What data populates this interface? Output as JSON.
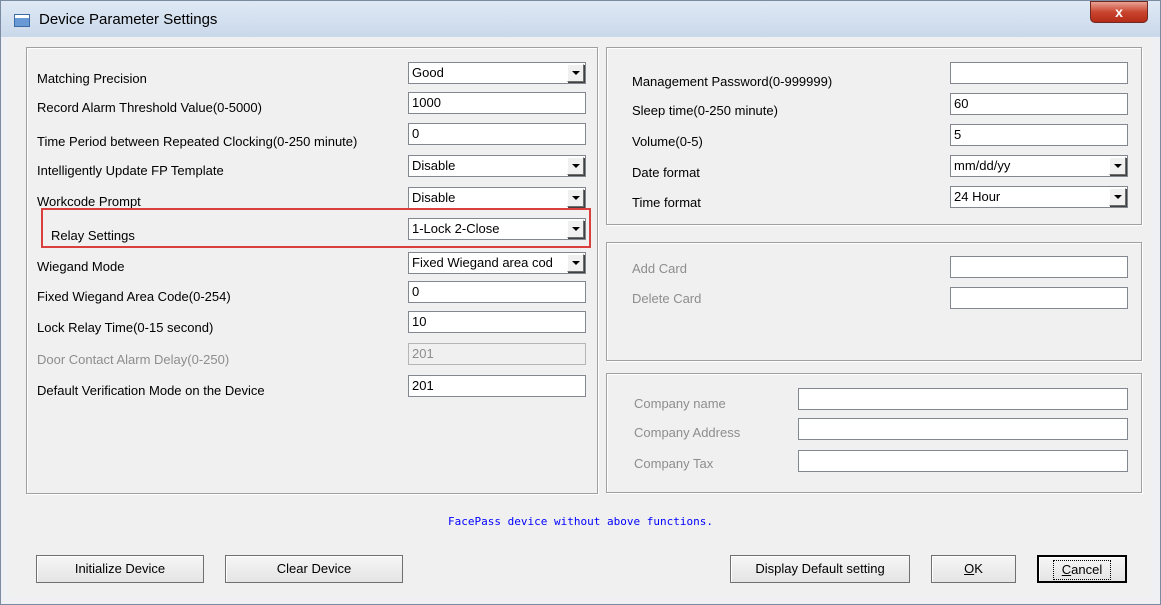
{
  "window": {
    "title": "Device Parameter Settings",
    "close_label": "x"
  },
  "left_panel": {
    "rows": [
      {
        "label": "Matching Precision",
        "value": "Good",
        "type": "combo"
      },
      {
        "label": "Record Alarm Threshold Value(0-5000)",
        "value": "1000",
        "type": "text"
      },
      {
        "label": "Time Period between Repeated Clocking(0-250 minute)",
        "value": "0",
        "type": "text"
      },
      {
        "label": "Intelligently Update  FP Template",
        "value": "Disable",
        "type": "combo"
      },
      {
        "label": "Workcode Prompt",
        "value": "Disable",
        "type": "combo"
      },
      {
        "label": "Relay Settings",
        "value": "1-Lock  2-Close",
        "type": "combo"
      },
      {
        "label": "Wiegand Mode",
        "value": "Fixed Wiegand area cod",
        "type": "combo"
      },
      {
        "label": "Fixed Wiegand Area Code(0-254)",
        "value": "0",
        "type": "text"
      },
      {
        "label": "Lock Relay Time(0-15 second)",
        "value": "10",
        "type": "text"
      },
      {
        "label": "Door Contact Alarm Delay(0-250)",
        "value": "201",
        "type": "text",
        "disabled": true
      },
      {
        "label": "Default Verification Mode on the Device",
        "value": "201",
        "type": "text"
      }
    ]
  },
  "right_top": {
    "rows": [
      {
        "label": "Management Password(0-999999)",
        "value": "",
        "type": "text"
      },
      {
        "label": "Sleep time(0-250 minute)",
        "value": "60",
        "type": "text"
      },
      {
        "label": "Volume(0-5)",
        "value": "5",
        "type": "text"
      },
      {
        "label": "Date format",
        "value": "mm/dd/yy",
        "type": "combo"
      },
      {
        "label": "Time format",
        "value": "24 Hour",
        "type": "combo"
      }
    ]
  },
  "card_panel": {
    "rows": [
      {
        "label": "Add Card",
        "value": ""
      },
      {
        "label": "Delete Card",
        "value": ""
      }
    ]
  },
  "company_panel": {
    "rows": [
      {
        "label": "Company name",
        "value": ""
      },
      {
        "label": "Company Address",
        "value": ""
      },
      {
        "label": "Company Tax",
        "value": ""
      }
    ]
  },
  "notice": "FacePass device without above functions.",
  "buttons": {
    "initialize": "Initialize Device",
    "clear": "Clear Device",
    "display_default": "Display Default setting",
    "ok_underlined": "O",
    "ok_rest": "K",
    "cancel_underlined": "C",
    "cancel_rest": "ancel"
  },
  "colors": {
    "highlight": "#d9403d",
    "notice": "#0000ff",
    "close": "#c9452f"
  }
}
